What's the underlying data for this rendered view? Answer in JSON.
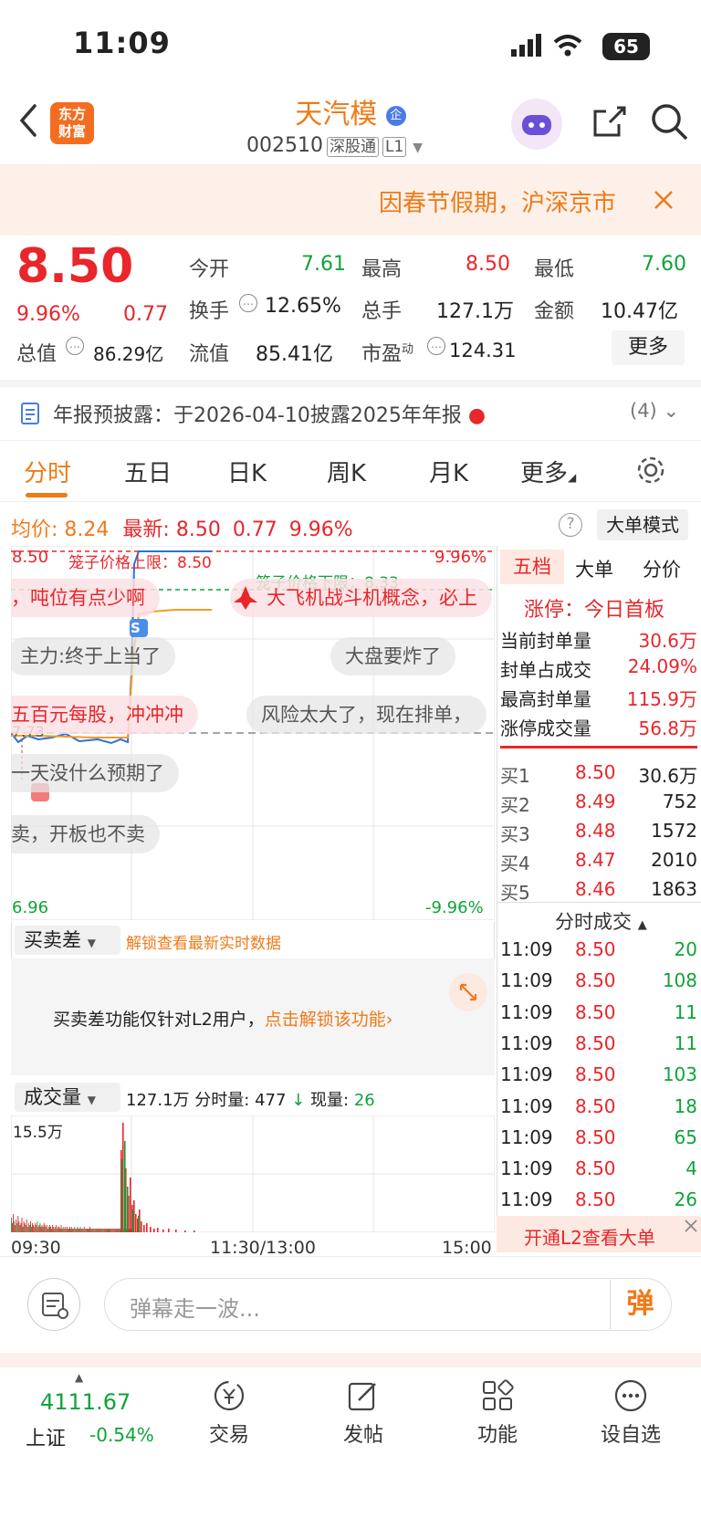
{
  "status_bar": {
    "time": "11:09",
    "battery": "65"
  },
  "header": {
    "logo_text": "东方\n财富",
    "stock_name": "天汽模",
    "name_badge": "企",
    "stock_code": "002510",
    "tag_connect": "深股通",
    "tag_level": "L1"
  },
  "banner": {
    "text": "因春节假期，沪深京市"
  },
  "quote": {
    "price": "8.50",
    "change_pct": "9.96%",
    "change": "0.77",
    "open_label": "今开",
    "open": "7.61",
    "high_label": "最高",
    "high": "8.50",
    "low_label": "最低",
    "low": "7.60",
    "turnover_label": "换手",
    "turnover": "12.65%",
    "volume_label": "总手",
    "volume": "127.1万",
    "amount_label": "金额",
    "amount": "10.47亿",
    "mktcap_label": "总值",
    "mktcap": "86.29亿",
    "float_label": "流值",
    "float": "85.41亿",
    "pe_label": "市盈",
    "pe_sup": "动",
    "pe": "124.31",
    "more": "更多"
  },
  "notice": {
    "label": "年报预披露：",
    "text": "于2026-04-10披露2025年年报",
    "count": "(4)"
  },
  "tabs": [
    "分时",
    "五日",
    "日K",
    "周K",
    "月K",
    "更多"
  ],
  "chart_info": {
    "avg_label": "均价:",
    "avg": "8.24",
    "latest_label": "最新:",
    "latest": "8.50",
    "chg": "0.77",
    "pct": "9.96%",
    "big_order_mode": "大单模式"
  },
  "chart": {
    "top_left": "8.50",
    "top_right": "9.96%",
    "bottom_left": "6.96",
    "bottom_right": "-9.96%",
    "mid_left": "7.73",
    "cage_upper": "笼子价格上限：8.50",
    "cage_lower": "笼子价格下限：8.33",
    "marker_s": "S",
    "marker_b": "B"
  },
  "chart_data": {
    "type": "line",
    "title": "",
    "xlabel": "",
    "ylabel": "",
    "x_ticks": [
      "09:30",
      "11:30/13:00",
      "15:00"
    ],
    "ylim": [
      6.96,
      8.5
    ],
    "prev_close": 7.73,
    "series": [
      {
        "values_time": [
          "09:30",
          "09:40",
          "09:50",
          "10:00",
          "10:10",
          "10:20",
          "10:30",
          "10:40",
          "10:50",
          "11:00",
          "11:09"
        ],
        "values": [
          7.72,
          7.65,
          7.68,
          7.64,
          7.66,
          7.62,
          7.65,
          7.66,
          7.7,
          8.1,
          8.5
        ]
      },
      {
        "values_time": [
          "09:30",
          "09:40",
          "09:50",
          "10:00",
          "10:10",
          "10:20",
          "10:30",
          "10:40",
          "10:50",
          "11:00",
          "11:09"
        ],
        "values": [
          7.7,
          7.69,
          7.68,
          7.67,
          7.66,
          7.66,
          7.66,
          7.66,
          7.67,
          7.95,
          8.24
        ]
      }
    ]
  },
  "danmu": [
    "，吨位有点少啊",
    "大飞机战斗机概念，必上",
    "主力:终于上当了",
    "大盘要炸了",
    "五百元每股，冲冲冲",
    "风险太大了，现在排单，",
    "一天没什么预期了",
    "卖，开板也不卖"
  ],
  "indicator": {
    "name": "买卖差",
    "unlock_link": "解锁查看最新实时数据",
    "info": "买卖差功能仅针对L2用户，",
    "info_link": "点击解锁该功能"
  },
  "volume_panel": {
    "name": "成交量",
    "total": "127.1万",
    "minute_label": "分时量:",
    "minute": "477",
    "now_label": "现量:",
    "now": "26",
    "max": "15.5万"
  },
  "volume_chart_data": {
    "type": "bar",
    "max": "15.5万"
  },
  "orderbook": {
    "tabs": [
      "五档",
      "大单",
      "分价"
    ],
    "limit_status": "涨停：今日首板",
    "stats": [
      {
        "label": "当前封单量",
        "value": "30.6万"
      },
      {
        "label": "封单占成交",
        "value": "24.09%"
      },
      {
        "label": "最高封单量",
        "value": "115.9万"
      },
      {
        "label": "涨停成交量",
        "value": "56.8万"
      }
    ],
    "bids": [
      {
        "label": "买1",
        "price": "8.50",
        "qty": "30.6万"
      },
      {
        "label": "买2",
        "price": "8.49",
        "qty": "752"
      },
      {
        "label": "买3",
        "price": "8.48",
        "qty": "1572"
      },
      {
        "label": "买4",
        "price": "8.47",
        "qty": "2010"
      },
      {
        "label": "买5",
        "price": "8.46",
        "qty": "1863"
      }
    ],
    "trades_title": "分时成交",
    "trades": [
      {
        "time": "11:09",
        "price": "8.50",
        "qty": "20"
      },
      {
        "time": "11:09",
        "price": "8.50",
        "qty": "108"
      },
      {
        "time": "11:09",
        "price": "8.50",
        "qty": "11"
      },
      {
        "time": "11:09",
        "price": "8.50",
        "qty": "11"
      },
      {
        "time": "11:09",
        "price": "8.50",
        "qty": "103"
      },
      {
        "time": "11:09",
        "price": "8.50",
        "qty": "18"
      },
      {
        "time": "11:09",
        "price": "8.50",
        "qty": "65"
      },
      {
        "time": "11:09",
        "price": "8.50",
        "qty": "4"
      },
      {
        "time": "11:09",
        "price": "8.50",
        "qty": "26"
      }
    ],
    "l2_promo": "开通L2查看大单"
  },
  "comment": {
    "placeholder": "弹幕走一波...",
    "send": "弹"
  },
  "bottom_nav": {
    "index_value": "4111.67",
    "index_name": "上证",
    "index_change": "-0.54%",
    "items": [
      "交易",
      "发帖",
      "功能",
      "设自选"
    ]
  },
  "colors": {
    "up": "#e8262b",
    "down": "#10a33a",
    "accent": "#f07a18"
  }
}
